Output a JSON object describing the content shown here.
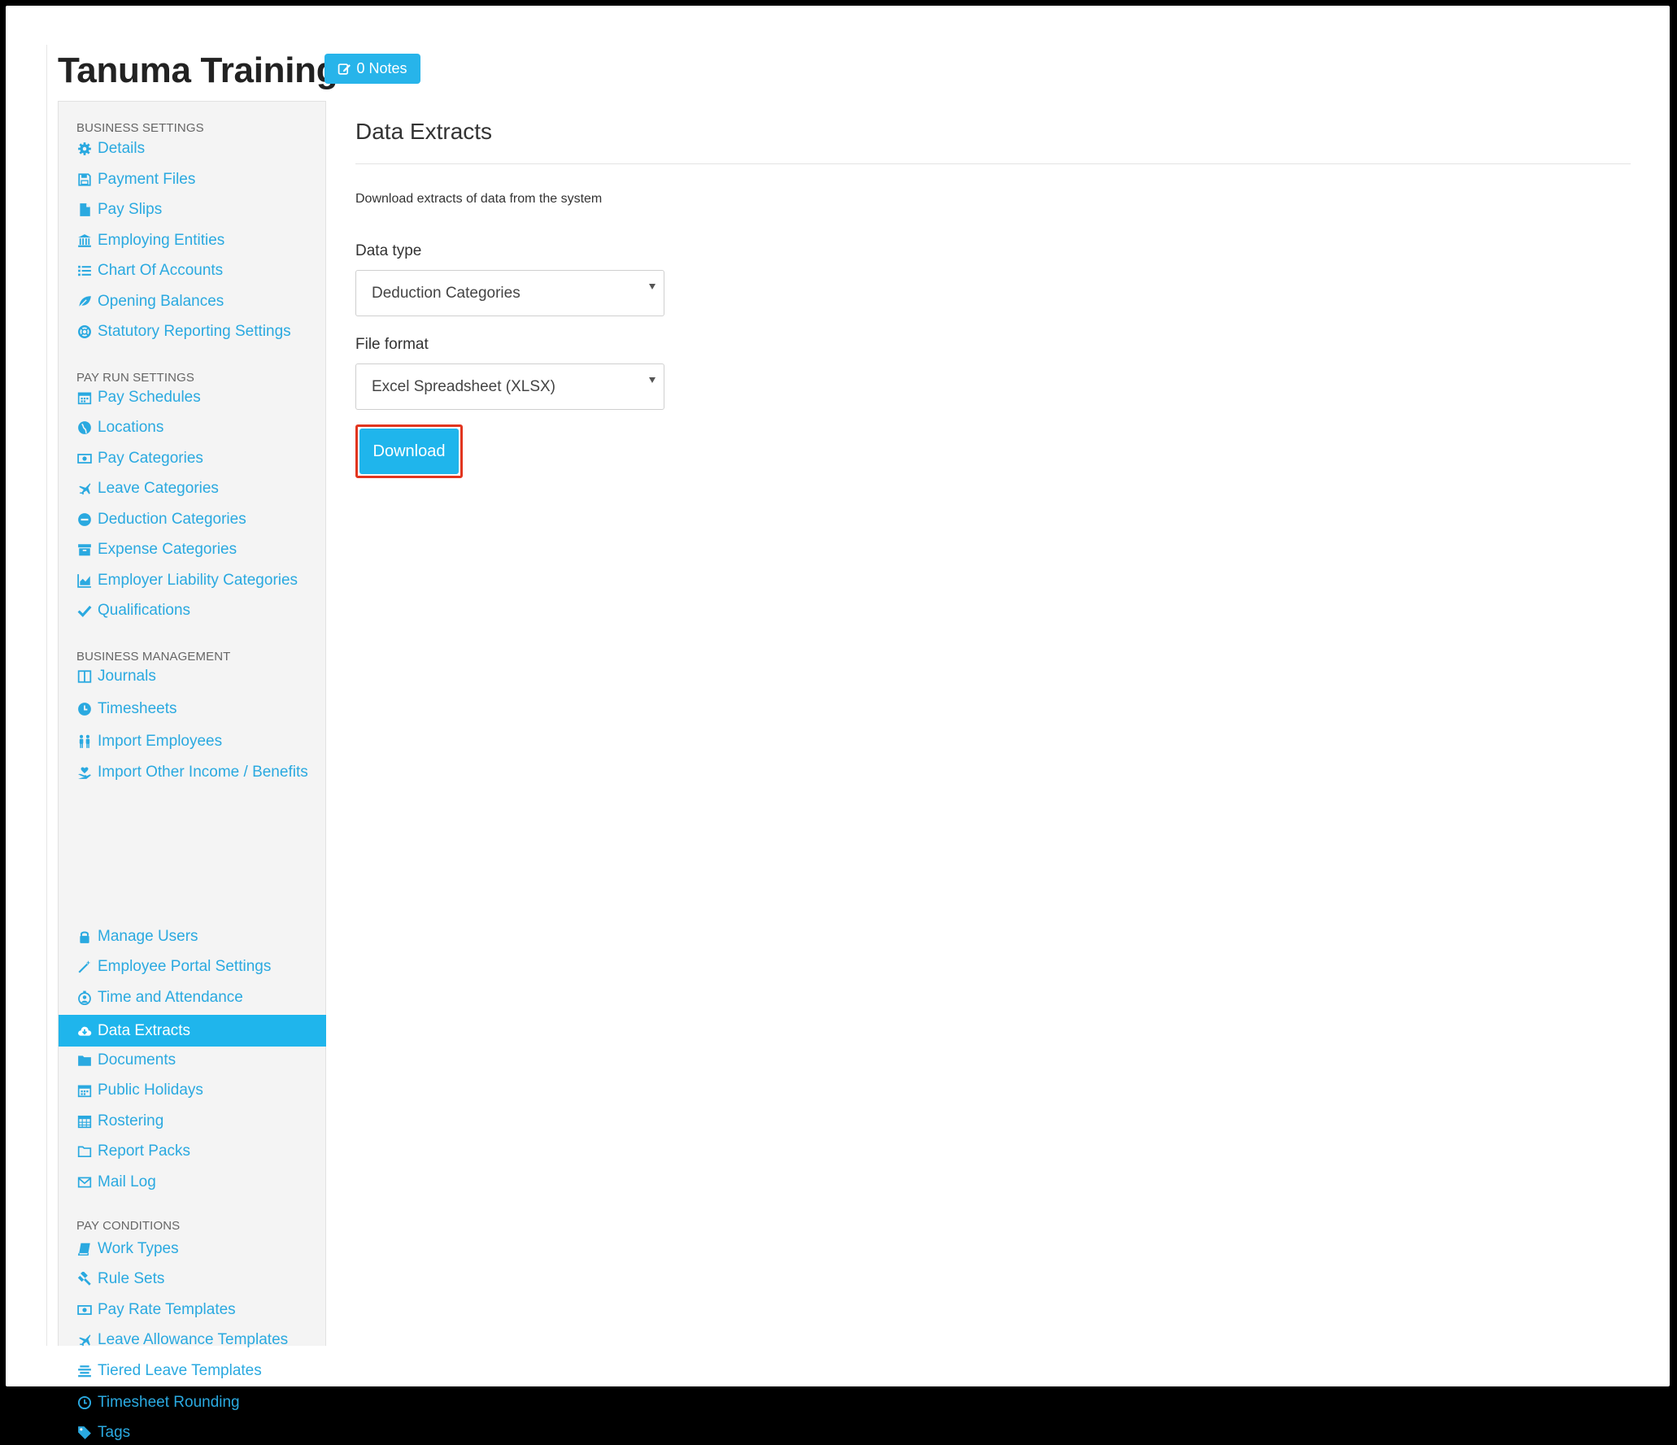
{
  "header": {
    "title": "Tanuma Training",
    "notes_label": "0 Notes"
  },
  "sidebar": {
    "sections": [
      {
        "header": "BUSINESS SETTINGS",
        "items": [
          {
            "label": "Details",
            "icon": "gear-icon"
          },
          {
            "label": "Payment Files",
            "icon": "floppy-icon"
          },
          {
            "label": "Pay Slips",
            "icon": "file-icon"
          },
          {
            "label": "Employing Entities",
            "icon": "bank-icon"
          },
          {
            "label": "Chart Of Accounts",
            "icon": "list-icon"
          },
          {
            "label": "Opening Balances",
            "icon": "leaf-icon"
          },
          {
            "label": "Statutory Reporting Settings",
            "icon": "lifebuoy-icon"
          }
        ]
      },
      {
        "header": "PAY RUN SETTINGS",
        "items": [
          {
            "label": "Pay Schedules",
            "icon": "calendar-icon"
          },
          {
            "label": "Locations",
            "icon": "globe-icon"
          },
          {
            "label": "Pay Categories",
            "icon": "money-icon"
          },
          {
            "label": "Leave Categories",
            "icon": "plane-icon"
          },
          {
            "label": "Deduction Categories",
            "icon": "minus-circle-icon"
          },
          {
            "label": "Expense Categories",
            "icon": "archive-icon"
          },
          {
            "label": "Employer Liability Categories",
            "icon": "area-chart-icon"
          },
          {
            "label": "Qualifications",
            "icon": "check-icon"
          }
        ]
      },
      {
        "header": "BUSINESS MANAGEMENT",
        "items": [
          {
            "label": "Journals",
            "icon": "columns-icon"
          },
          {
            "label": "Timesheets",
            "icon": "clock-icon"
          },
          {
            "label": "Import Employees",
            "icon": "people-icon"
          },
          {
            "label": "Import Other Income / Benefits",
            "icon": "hand-heart-icon"
          },
          {
            "label": "Manage Users",
            "icon": "lock-icon"
          },
          {
            "label": "Employee Portal Settings",
            "icon": "magic-wand-icon"
          },
          {
            "label": "Time and Attendance",
            "icon": "user-clock-icon"
          },
          {
            "label": "Data Extracts",
            "icon": "cloud-download-icon",
            "active": true
          },
          {
            "label": "Documents",
            "icon": "folder-icon"
          },
          {
            "label": "Public Holidays",
            "icon": "calendar-icon"
          },
          {
            "label": "Rostering",
            "icon": "calendar-grid-icon"
          },
          {
            "label": "Report Packs",
            "icon": "folder-outline-icon"
          },
          {
            "label": "Mail Log",
            "icon": "envelope-icon"
          }
        ]
      },
      {
        "header": "PAY CONDITIONS",
        "items": [
          {
            "label": "Work Types",
            "icon": "book-icon"
          },
          {
            "label": "Rule Sets",
            "icon": "gavel-icon"
          },
          {
            "label": "Pay Rate Templates",
            "icon": "money-icon"
          },
          {
            "label": "Leave Allowance Templates",
            "icon": "plane-icon"
          },
          {
            "label": "Tiered Leave Templates",
            "icon": "align-center-icon"
          },
          {
            "label": "Timesheet Rounding",
            "icon": "clock-outline-icon"
          },
          {
            "label": "Tags",
            "icon": "tag-icon"
          }
        ]
      }
    ]
  },
  "main": {
    "title": "Data Extracts",
    "description": "Download extracts of data from the system",
    "data_type_label": "Data type",
    "data_type_value": "Deduction Categories",
    "file_format_label": "File format",
    "file_format_value": "Excel Spreadsheet (XLSX)",
    "download_label": "Download"
  },
  "colors": {
    "accent": "#1fb5ec",
    "link": "#2aa9e0",
    "highlight_outline": "#e2351f"
  }
}
